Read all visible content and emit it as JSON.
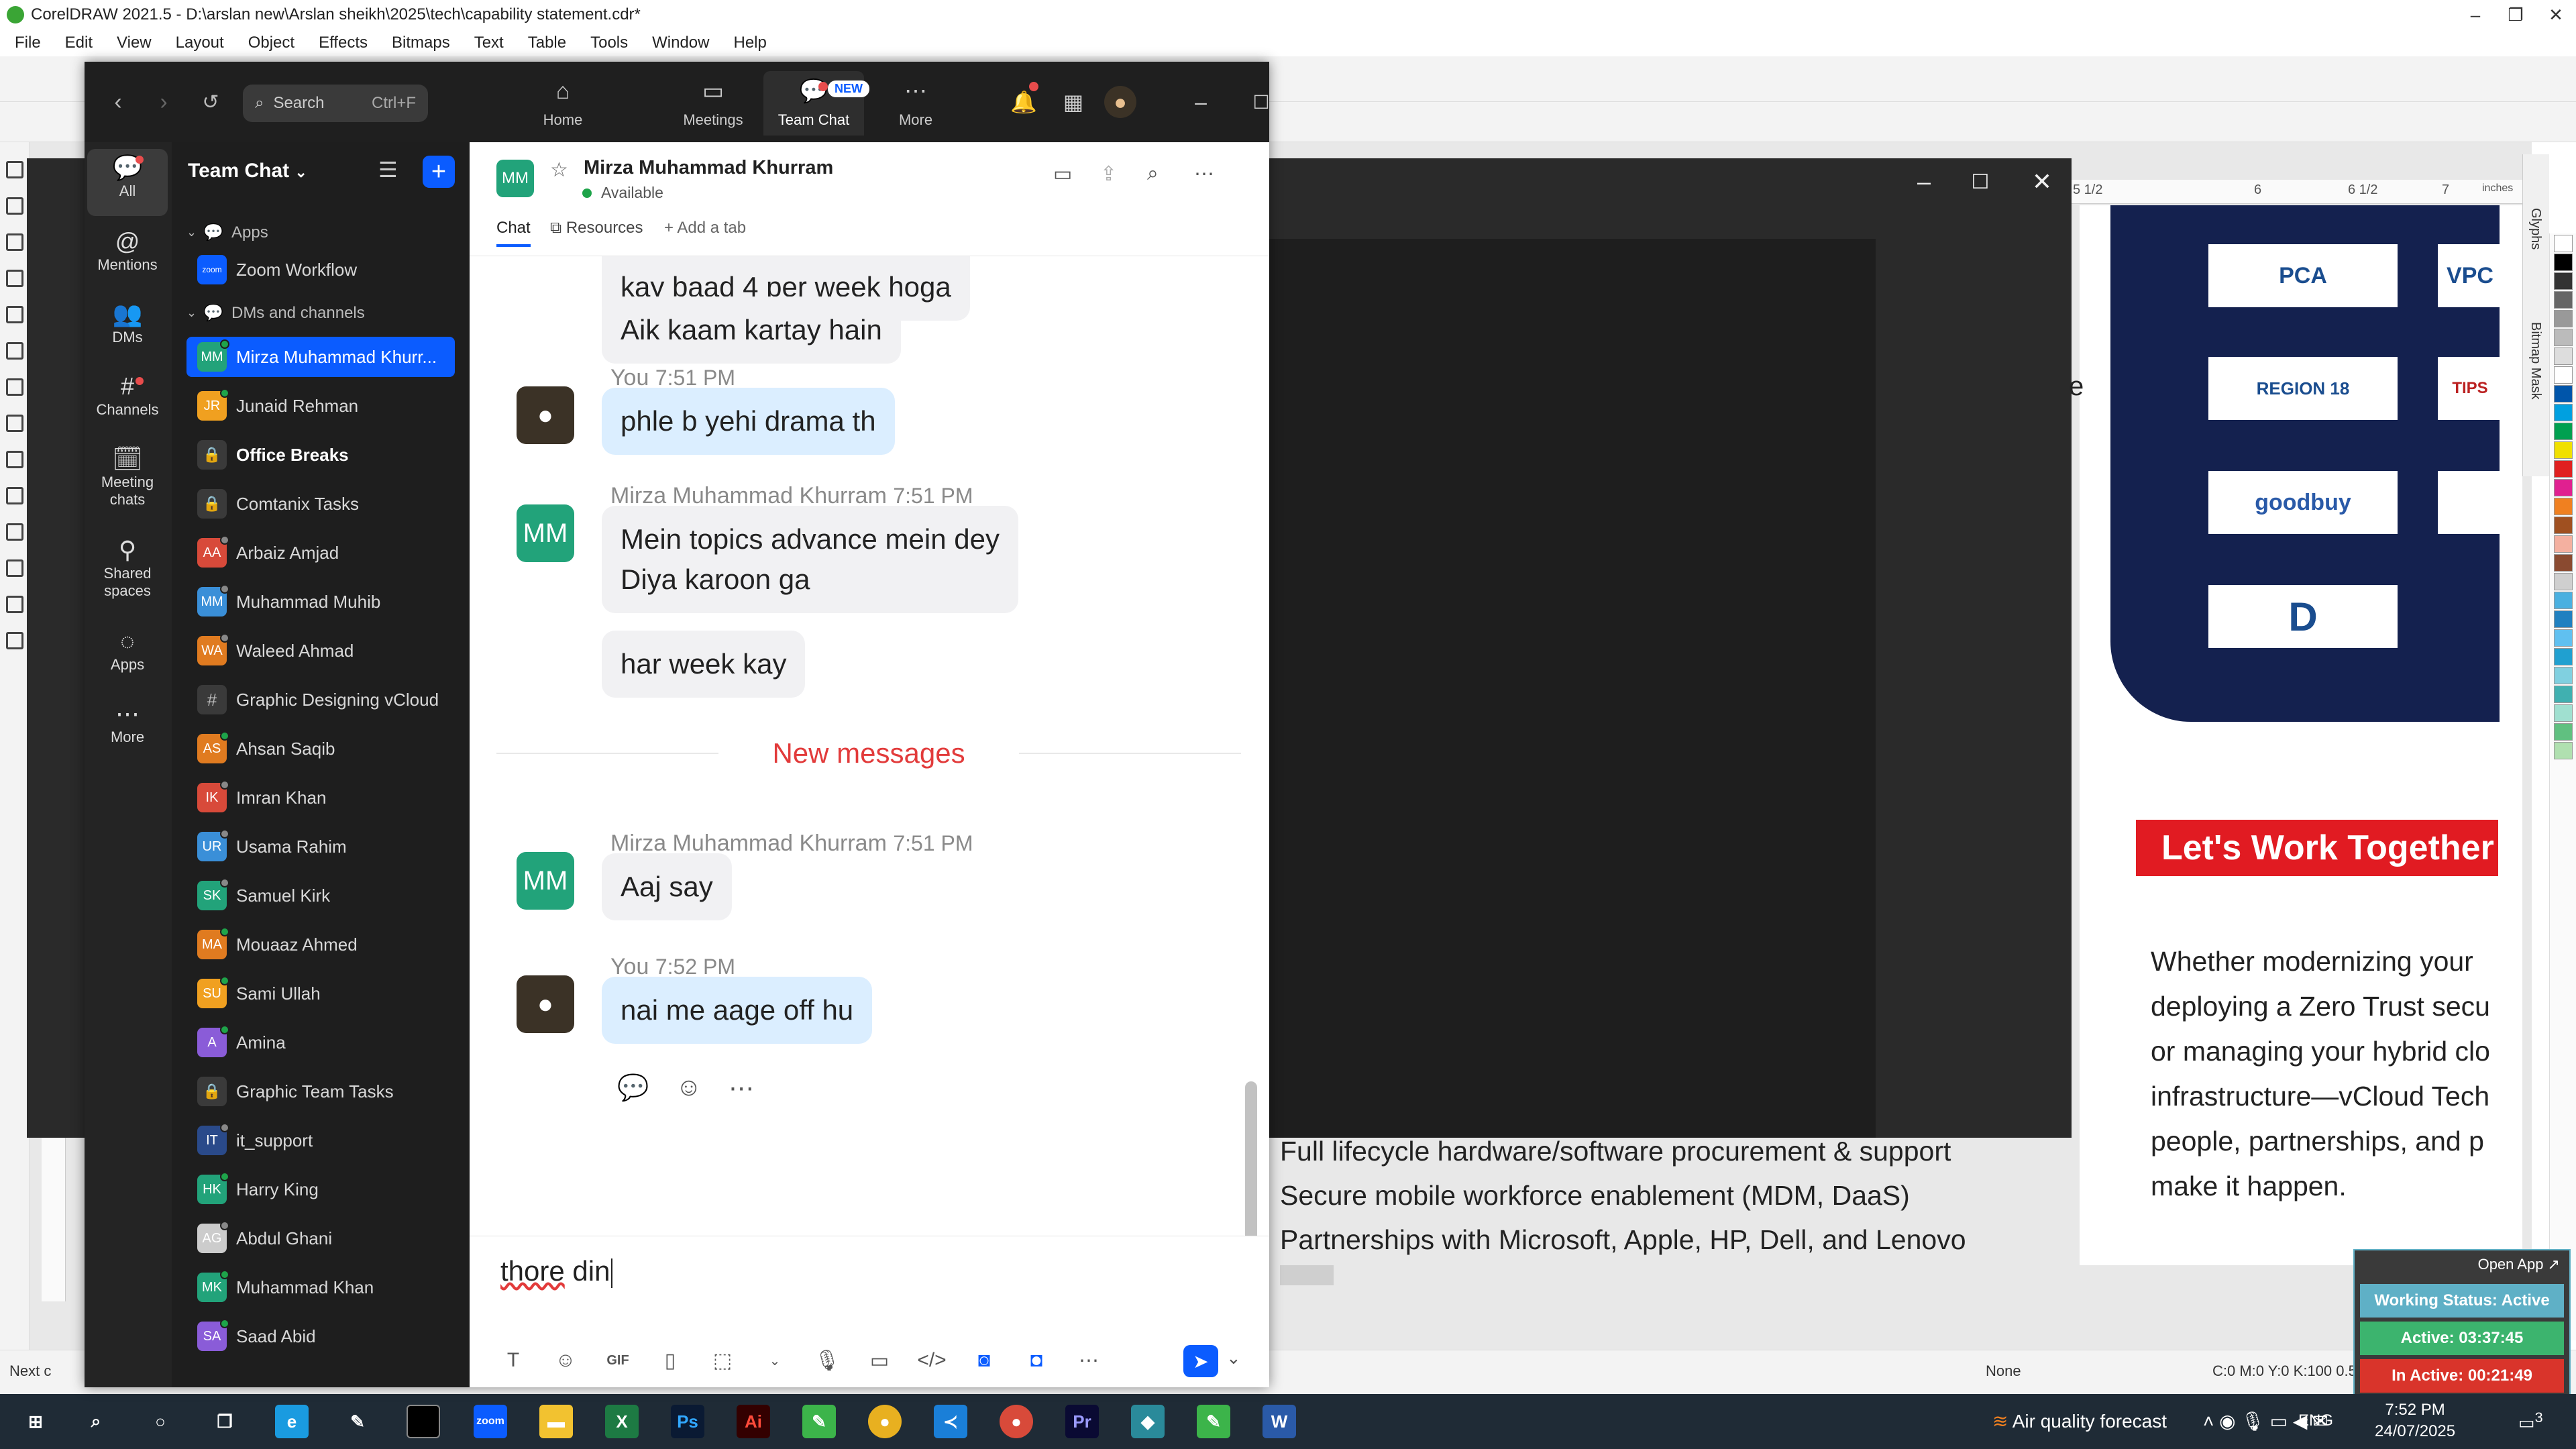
{
  "corel": {
    "title": "CorelDRAW 2021.5 - D:\\arslan new\\Arslan sheikh\\2025\\tech\\capability statement.cdr*",
    "menu": [
      "File",
      "Edit",
      "View",
      "Layout",
      "Object",
      "Effects",
      "Bitmaps",
      "Text",
      "Table",
      "Tools",
      "Window",
      "Help"
    ],
    "page_size": "A4",
    "ruler_labels": [
      "5 1/2",
      "6",
      "6 1/2",
      "7",
      "inches"
    ],
    "docker_labels": [
      "Glyphs",
      "Bitmap Mask"
    ],
    "logos": [
      "PCA",
      "VPC",
      "REGION 18",
      "TIPS",
      "goodbuy",
      "D"
    ],
    "banner": "Let's Work Together",
    "paragraph": [
      "Whether modernizing your",
      "deploying a Zero Trust secu",
      "or managing your hybrid clo",
      "infrastructure—vCloud Tech",
      "people, partnerships, and p",
      "make it happen."
    ],
    "paragraph_bold_tail": "vCloud Tech",
    "list": [
      "Full lifecycle hardware/software procurement & support",
      "Secure mobile workforce enablement (MDM, DaaS)",
      "Partnerships with Microsoft, Apple, HP, Dell, and Lenovo"
    ],
    "status_fill": "None",
    "status_cmyk": "C:0 M:0 Y:0 K:100  0.500 pt",
    "status_next": "Next c",
    "dark_window_letter": "e"
  },
  "tracker": {
    "open_app": "Open App ↗",
    "working_status": "Working Status: Active",
    "active": "Active: 03:37:45",
    "inactive": "In Active: 00:21:49",
    "colors": {
      "status": "#5fb0c6",
      "active": "#3cb46e",
      "inactive": "#d9342b"
    }
  },
  "taskbar": {
    "air_quality": "Air quality forecast",
    "lang": "ENG",
    "time": "7:52 PM",
    "date": "24/07/2025",
    "notifications": "3"
  },
  "zoom": {
    "search_placeholder": "Search",
    "search_shortcut": "Ctrl+F",
    "tabs": [
      {
        "label": "Home",
        "icon": "⌂"
      },
      {
        "label": "Meetings",
        "icon": "▭"
      },
      {
        "label": "Team Chat",
        "icon": "💬"
      },
      {
        "label": "More",
        "icon": "⋯"
      }
    ],
    "new_badge": "NEW",
    "rail": [
      {
        "label": "All",
        "icon": "💬"
      },
      {
        "label": "Mentions",
        "icon": "@"
      },
      {
        "label": "DMs",
        "icon": "👥"
      },
      {
        "label": "Channels",
        "icon": "#"
      },
      {
        "label": "Meeting chats",
        "icon": "🗓"
      },
      {
        "label": "Shared spaces",
        "icon": "⚲"
      },
      {
        "label": "Apps",
        "icon": "◌"
      },
      {
        "label": "More",
        "icon": "⋯"
      }
    ],
    "sidebar": {
      "title": "Team Chat",
      "apps_section": "Apps",
      "apps": [
        {
          "name": "Zoom Workflow",
          "initials": "zoom",
          "color": "#0b5cff"
        }
      ],
      "dm_section": "DMs and channels",
      "items": [
        {
          "name": "Mirza Muhammad Khurr...",
          "initials": "MM",
          "color": "#22a37a",
          "status": "#1ea44a",
          "kind": "dm",
          "selected": true
        },
        {
          "name": "Junaid Rehman",
          "initials": "JR",
          "color": "#f0a020",
          "status": "#1ea44a",
          "kind": "dm"
        },
        {
          "name": "Office Breaks",
          "initials": "🔒",
          "color": "#3a3a3a",
          "kind": "lock",
          "bold": true
        },
        {
          "name": "Comtanix Tasks",
          "initials": "🔒",
          "color": "#3a3a3a",
          "kind": "lock"
        },
        {
          "name": "Arbaiz Amjad",
          "initials": "AA",
          "color": "#d84a3a",
          "status": "#888",
          "kind": "dm"
        },
        {
          "name": "Muhammad Muhib",
          "initials": "MM",
          "color": "#3a8fd8",
          "status": "#888",
          "kind": "dm"
        },
        {
          "name": "Waleed Ahmad",
          "initials": "WA",
          "color": "#e07b20",
          "status": "#888",
          "kind": "dm"
        },
        {
          "name": "Graphic Designing vCloud",
          "initials": "#",
          "color": "#3a3a3a",
          "kind": "hash"
        },
        {
          "name": "Ahsan Saqib",
          "initials": "AS",
          "color": "#e07b20",
          "status": "#1ea44a",
          "kind": "dm"
        },
        {
          "name": "Imran Khan",
          "initials": "IK",
          "color": "#d84a3a",
          "status": "#888",
          "kind": "dm"
        },
        {
          "name": "Usama Rahim",
          "initials": "UR",
          "color": "#3a8fd8",
          "status": "#888",
          "kind": "dm"
        },
        {
          "name": "Samuel Kirk",
          "initials": "SK",
          "color": "#22a37a",
          "status": "#888",
          "kind": "dm"
        },
        {
          "name": "Mouaaz Ahmed",
          "initials": "MA",
          "color": "#e07b20",
          "status": "#1ea44a",
          "kind": "dm"
        },
        {
          "name": "Sami Ullah",
          "initials": "SU",
          "color": "#f0a020",
          "status": "#1ea44a",
          "kind": "dm"
        },
        {
          "name": "Amina",
          "initials": "A",
          "color": "#8a5cd8",
          "status": "#1ea44a",
          "kind": "dm"
        },
        {
          "name": "Graphic Team Tasks",
          "initials": "🔒",
          "color": "#3a3a3a",
          "kind": "lock"
        },
        {
          "name": "it_support",
          "initials": "IT",
          "color": "#2a4a8a",
          "status": "#888",
          "kind": "dm"
        },
        {
          "name": "Harry King",
          "initials": "HK",
          "color": "#22a37a",
          "status": "#1ea44a",
          "kind": "dm"
        },
        {
          "name": "Abdul Ghani",
          "initials": "AG",
          "color": "#cccccc",
          "status": "#888",
          "kind": "dm"
        },
        {
          "name": "Muhammad Khan",
          "initials": "MK",
          "color": "#22a37a",
          "status": "#1ea44a",
          "kind": "dm"
        },
        {
          "name": "Saad Abid",
          "initials": "SA",
          "color": "#8a5cd8",
          "status": "#1ea44a",
          "kind": "dm"
        }
      ]
    },
    "chat": {
      "contact_initials": "MM",
      "contact_name": "Mirza Muhammad Khurram",
      "contact_status": "Available",
      "tabs": [
        "Chat",
        "Resources",
        "+ Add a tab"
      ],
      "messages": [
        {
          "text": "kay baad 4 per week hoga"
        },
        {
          "text": "Aik kaam kartay hain"
        },
        {
          "sender": "You",
          "time": "7:51 PM",
          "text": "phle b yehi drama th"
        },
        {
          "sender": "Mirza Muhammad Khurram",
          "time": "7:51 PM",
          "text": "Mein topics advance mein dey",
          "text2": "Diya karoon ga"
        },
        {
          "text": "har week kay"
        },
        {
          "sender": "Mirza Muhammad Khurram",
          "time": "7:51 PM",
          "text": "Aaj say"
        },
        {
          "sender": "You",
          "time": "7:52 PM",
          "text": "nai me aage off hu"
        }
      ],
      "new_messages": "New messages",
      "compose_word1": "thore",
      "compose_word2": "din"
    }
  }
}
